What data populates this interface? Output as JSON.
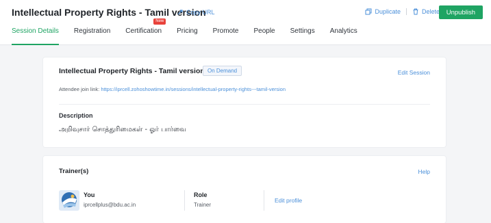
{
  "header": {
    "title": "Intellectual Property Rights - Tamil version",
    "copy_url": "Copy URL",
    "duplicate": "Duplicate",
    "delete": "Delete",
    "unpublish": "Unpublish"
  },
  "tabs": [
    {
      "label": "Session Details",
      "active": true
    },
    {
      "label": "Registration"
    },
    {
      "label": "Certification",
      "badge": "New"
    },
    {
      "label": "Pricing"
    },
    {
      "label": "Promote"
    },
    {
      "label": "People"
    },
    {
      "label": "Settings"
    },
    {
      "label": "Analytics"
    }
  ],
  "session": {
    "title": "Intellectual Property Rights - Tamil version",
    "status": "On Demand",
    "edit": "Edit Session",
    "join_label": "Attendee join link:",
    "join_url": "https://iprcell.zohoshowtime.in/sessions/intellectual-property-rights---tamil-version",
    "description_label": "Description",
    "description": "அறிவுசார் சொத்துரிமைகள் - ஓர் பார்வை"
  },
  "trainers": {
    "label": "Trainer(s)",
    "help": "Help",
    "items": [
      {
        "name": "You",
        "email": "iprcellplus@bdu.ac.in",
        "role_label": "Role",
        "role": "Trainer",
        "edit": "Edit profile"
      }
    ]
  },
  "colors": {
    "accent": "#1fa463",
    "link": "#4a8fd9",
    "badge": "#e8423b"
  }
}
